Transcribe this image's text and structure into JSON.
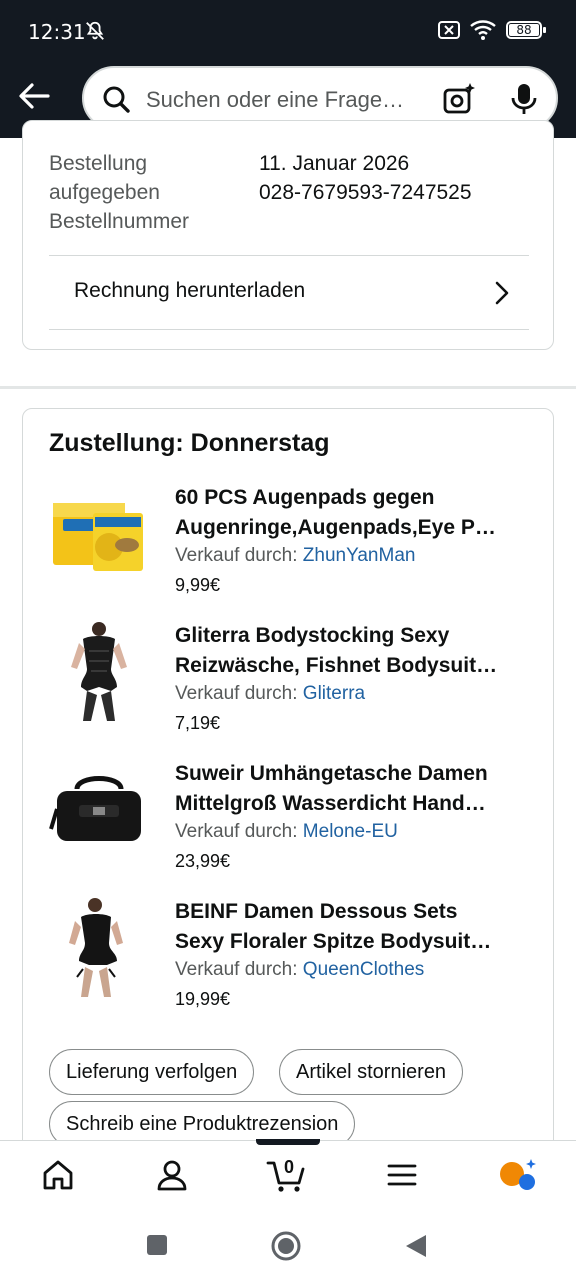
{
  "status": {
    "time": "12:31",
    "battery": "88"
  },
  "search": {
    "placeholder": "Suchen oder eine Frage…"
  },
  "order": {
    "labels": [
      "Bestellung",
      "aufgegeben",
      "Bestellnummer"
    ],
    "values": [
      "11. Januar 2026",
      "028-7679593-7247525"
    ],
    "invoice_label": "Rechnung herunterladen"
  },
  "delivery": {
    "title": "Zustellung: Donnerstag",
    "seller_prefix": "Verkauf durch: ",
    "items": [
      {
        "line1": "60 PCS Augenpads gegen",
        "line2": "Augenringe,Augenpads,Eye P…",
        "seller": "ZhunYanMan",
        "price": "9,99€"
      },
      {
        "line1": "Gliterra Bodystocking Sexy",
        "line2": "Reizwäsche, Fishnet Bodysuit…",
        "seller": "Gliterra",
        "price": "7,19€"
      },
      {
        "line1": "Suweir Umhängetasche Damen",
        "line2": "Mittelgroß Wasserdicht Hand…",
        "seller": "Melone-EU",
        "price": "23,99€"
      },
      {
        "line1": "BEINF Damen Dessous Sets",
        "line2": "Sexy Floraler Spitze Bodysuit…",
        "seller": "QueenClothes",
        "price": "19,99€"
      }
    ],
    "buttons": {
      "track": "Lieferung verfolgen",
      "cancel": "Artikel stornieren",
      "review": "Schreib eine Produktrezension"
    }
  },
  "nav": {
    "cart_count": "0"
  },
  "colors": {
    "header": "#131921",
    "link": "#2162a1",
    "accent": "#f08804"
  }
}
